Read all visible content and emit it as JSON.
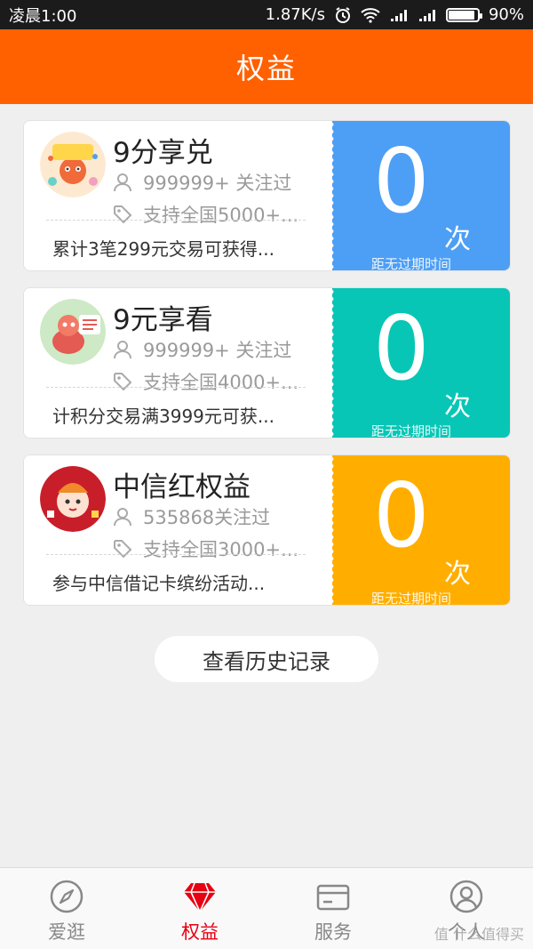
{
  "status": {
    "time": "凌晨1:00",
    "speed": "1.87K/s",
    "battery": "90%",
    "battery_level": 0.9
  },
  "header": {
    "title": "权益"
  },
  "cards": [
    {
      "title": "9分享兑",
      "follow": "999999+ 关注过",
      "support": "支持全国5000+...",
      "desc": "累计3笔299元交易可获得...",
      "count": "0",
      "unit": "次",
      "expire": "距无过期时间",
      "color": "#4d9ff5"
    },
    {
      "title": "9元享看",
      "follow": "999999+ 关注过",
      "support": "支持全国4000+...",
      "desc": "计积分交易满3999元可获...",
      "count": "0",
      "unit": "次",
      "expire": "距无过期时间",
      "color": "#08c6b6"
    },
    {
      "title": "中信红权益",
      "follow": "535868关注过",
      "support": "支持全国3000+...",
      "desc": "参与中信借记卡缤纷活动...",
      "count": "0",
      "unit": "次",
      "expire": "距无过期时间",
      "color": "#ffae00"
    }
  ],
  "history_button": "查看历史记录",
  "tabs": [
    {
      "label": "爱逛",
      "icon": "compass-icon"
    },
    {
      "label": "权益",
      "icon": "diamond-icon"
    },
    {
      "label": "服务",
      "icon": "card-icon"
    },
    {
      "label": "个人",
      "icon": "person-icon"
    }
  ],
  "watermark": "值 什么值得买",
  "colors": {
    "header": "#ff6000",
    "active_tab": "#e60012"
  }
}
